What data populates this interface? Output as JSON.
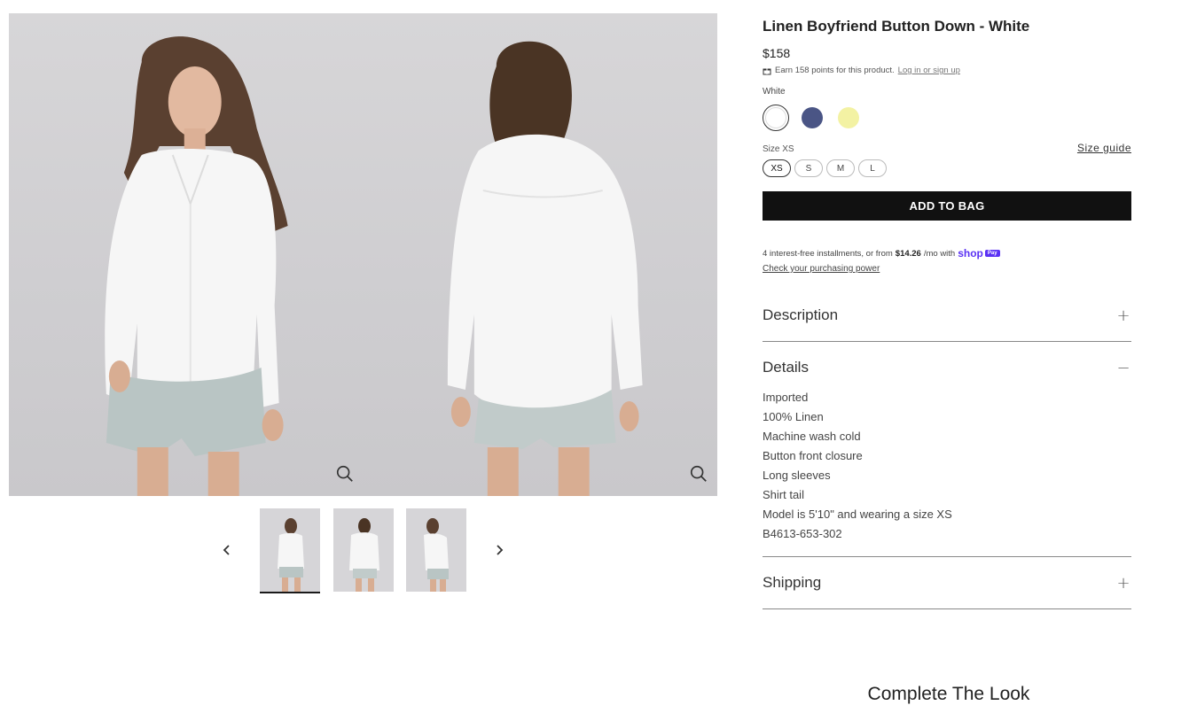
{
  "product": {
    "title": "Linen Boyfriend Button Down - White",
    "price": "$158",
    "points_text": "Earn 158 points for this product.",
    "points_link": "Log in or sign up",
    "color_label": "White",
    "colors": [
      {
        "name": "White",
        "hex": "#ffffff",
        "selected": true
      },
      {
        "name": "Navy",
        "hex": "#4a5585",
        "selected": false
      },
      {
        "name": "Yellow",
        "hex": "#f3f2a3",
        "selected": false
      }
    ],
    "size_label": "Size XS",
    "size_guide": "Size guide",
    "sizes": [
      "XS",
      "S",
      "M",
      "L"
    ],
    "add_to_bag": "ADD TO BAG"
  },
  "installments": {
    "prefix": "4 interest-free installments, or from",
    "amount": "$14.26",
    "suffix": "/mo with",
    "brand": "shop",
    "brand_badge": "Pay",
    "link": "Check your purchasing power"
  },
  "accordion": {
    "description": {
      "title": "Description",
      "toggle": "+"
    },
    "details": {
      "title": "Details",
      "toggle": "−",
      "items": [
        "Imported",
        "100% Linen",
        "Machine wash cold",
        "Button front closure",
        "Long sleeves",
        "Shirt tail",
        "Model is 5'10\" and wearing a size XS",
        "B4613-653-302"
      ]
    },
    "shipping": {
      "title": "Shipping",
      "toggle": "+"
    }
  },
  "gallery": {
    "thumb_count": 3,
    "active_thumb": 1
  },
  "complete_the_look": "Complete The Look",
  "colors_ui": {
    "button_bg": "#111111",
    "shop_pay": "#5a31f4"
  }
}
